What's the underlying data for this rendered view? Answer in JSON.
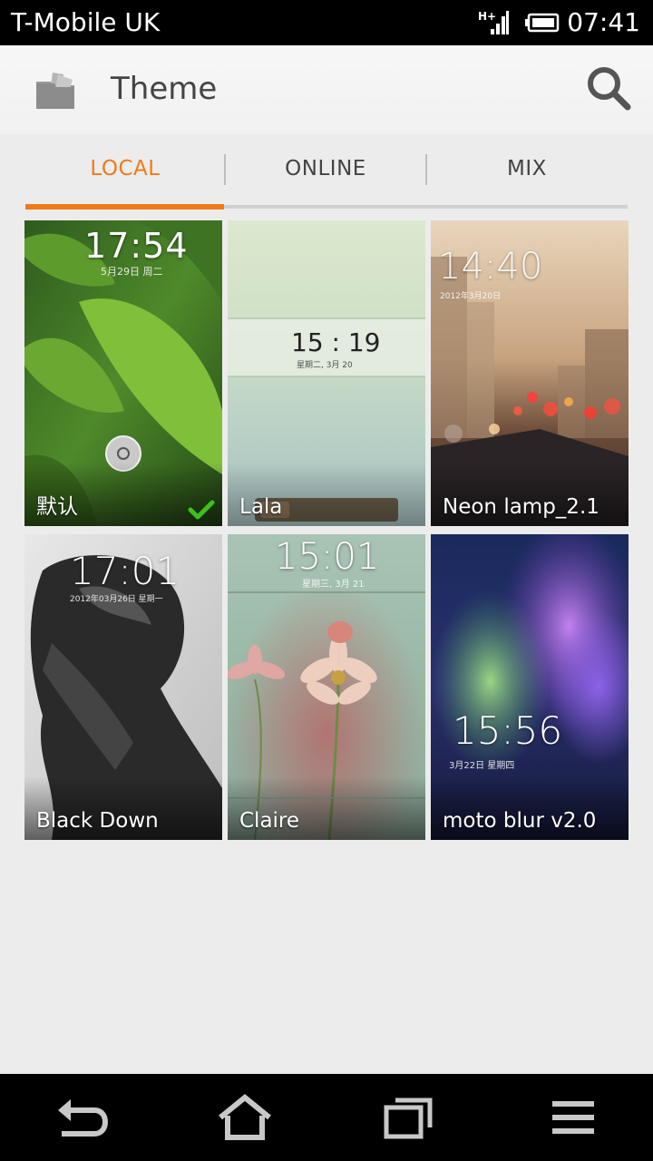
{
  "status_bar": {
    "carrier": "T-Mobile UK",
    "time": "07:41",
    "network_icon": "signal-hplus-icon",
    "battery_icon": "battery-icon"
  },
  "action_bar": {
    "title": "Theme",
    "app_icon": "theme-app-icon",
    "search_icon": "search-icon"
  },
  "tabs": [
    {
      "label": "LOCAL",
      "active": true
    },
    {
      "label": "ONLINE",
      "active": false
    },
    {
      "label": "MIX",
      "active": false
    }
  ],
  "themes": [
    {
      "name": "默认",
      "clock": "17:54",
      "date": "5月29日 周二",
      "applied": true
    },
    {
      "name": "Lala",
      "clock": "15 : 19",
      "date": "星期二, 3月 20"
    },
    {
      "name": "Neon lamp_2.1",
      "clock": "14:40",
      "date": "2012年3月20日"
    },
    {
      "name": "Black Down",
      "clock": "17:01",
      "date": "2012年03月26日 星期一"
    },
    {
      "name": "Claire",
      "clock": "15:01",
      "date": "星期三, 3月 21"
    },
    {
      "name": "moto blur v2.0",
      "clock": "15:56",
      "date": "3月22日 星期四"
    }
  ],
  "colors": {
    "accent": "#f07a1a",
    "applied_check": "#3fbf1f"
  },
  "nav_bar": {
    "back_icon": "back-icon",
    "home_icon": "home-icon",
    "recents_icon": "recent-apps-icon",
    "menu_icon": "menu-icon"
  }
}
